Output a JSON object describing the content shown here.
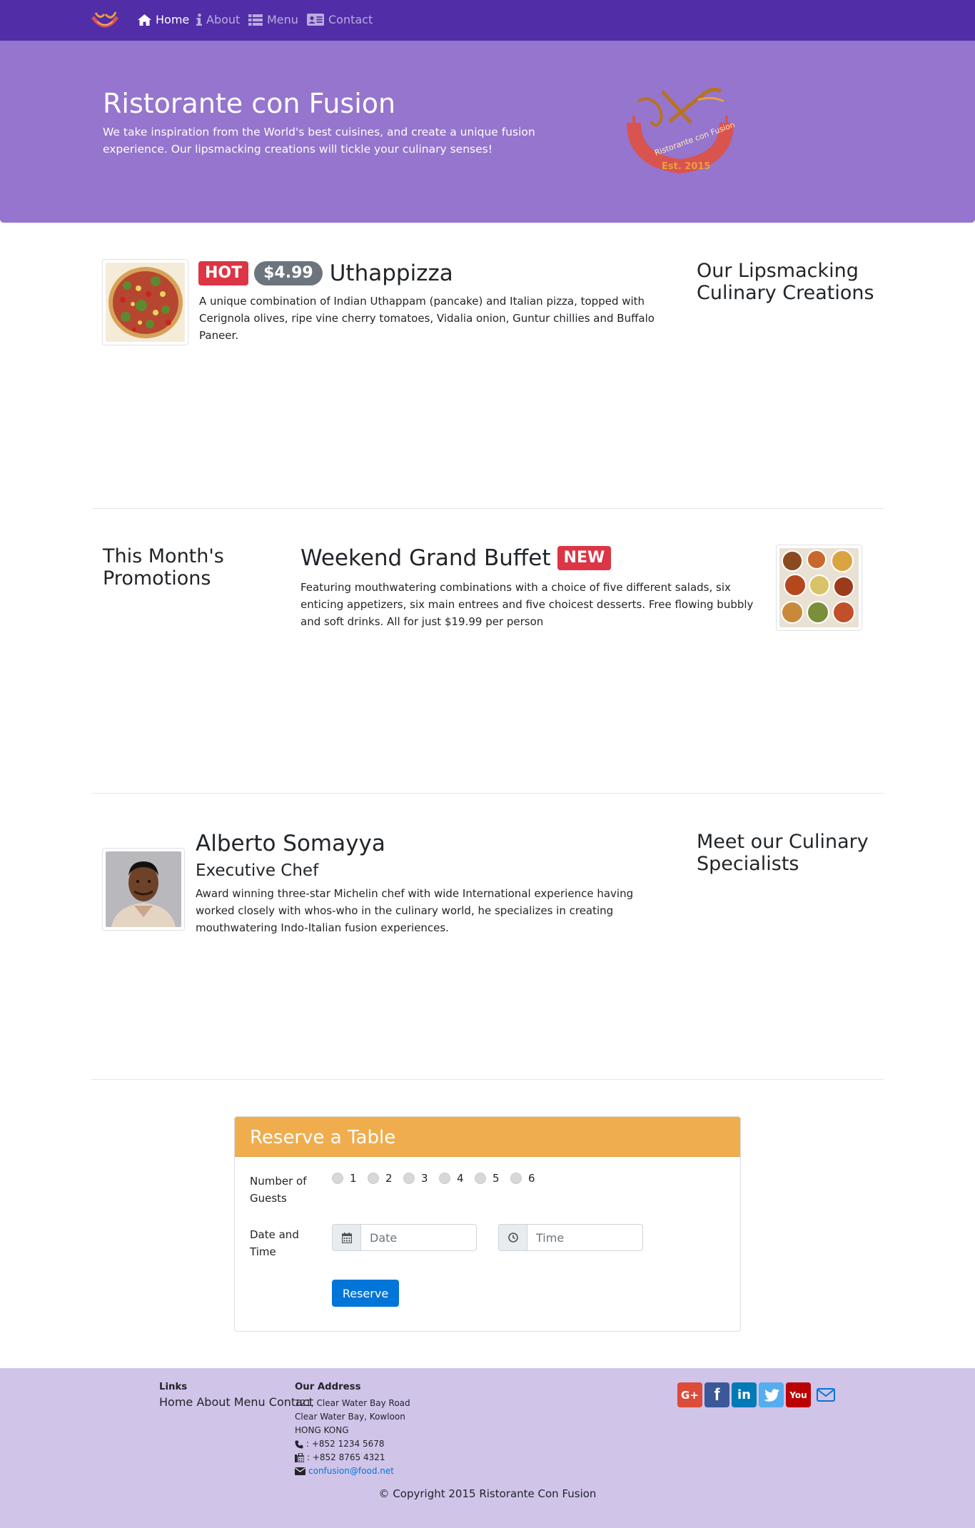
{
  "nav": {
    "brand_icon": "confusion-logo-icon",
    "items": [
      {
        "label": "Home",
        "icon": "home-icon",
        "active": true
      },
      {
        "label": "About",
        "icon": "info-icon"
      },
      {
        "label": "Menu",
        "icon": "list-icon"
      },
      {
        "label": "Contact",
        "icon": "address-card-icon"
      }
    ]
  },
  "jumbotron": {
    "title": "Ristorante con Fusion",
    "text": "We take inspiration from the World's best cuisines, and create a unique fusion experience. Our lipsmacking creations will tickle your culinary senses!",
    "logo_text": "Ristorante con Fusion",
    "logo_est": "Est. 2015"
  },
  "dish": {
    "badge_hot": "HOT",
    "price": "$4.99",
    "name": "Uthappizza",
    "description": "A unique combination of Indian Uthappam (pancake) and Italian pizza, topped with Cerignola olives, ripe vine cherry tomatoes, Vidalia onion, Guntur chillies and Buffalo Paneer.",
    "side_heading": "Our Lipsmacking Culinary Creations"
  },
  "promotion": {
    "side_heading": "This Month's Promotions",
    "name": "Weekend Grand Buffet",
    "badge_new": "NEW",
    "description": "Featuring mouthwatering combinations with a choice of five different salads, six enticing appetizers, six main entrees and five choicest desserts. Free flowing bubbly and soft drinks. All for just $19.99 per person"
  },
  "leader": {
    "name": "Alberto Somayya",
    "designation": "Executive Chef",
    "description": "Award winning three-star Michelin chef with wide International experience having worked closely with whos-who in the culinary world, he specializes in creating mouthwatering Indo-Italian fusion experiences.",
    "side_heading": "Meet our Culinary Specialists"
  },
  "reserve": {
    "title": "Reserve a Table",
    "guests_label": "Number of Guests",
    "guest_options": [
      "1",
      "2",
      "3",
      "4",
      "5",
      "6"
    ],
    "datetime_label": "Date and Time",
    "date_placeholder": "Date",
    "time_placeholder": "Time",
    "button_label": "Reserve"
  },
  "footer": {
    "links_heading": "Links",
    "links": [
      "Home",
      "About",
      "Menu",
      "Contact"
    ],
    "address_heading": "Our Address",
    "address_lines": [
      "121, Clear Water Bay Road",
      "Clear Water Bay, Kowloon",
      "HONG KONG"
    ],
    "phone": ": +852 1234 5678",
    "fax": ": +852 8765 4321",
    "email": "confusion@food.net",
    "social": [
      {
        "icon": "google-plus-icon",
        "color": "#dd4b39",
        "glyph": "G+"
      },
      {
        "icon": "facebook-icon",
        "color": "#3b5998",
        "glyph": "f"
      },
      {
        "icon": "linkedin-icon",
        "color": "#007bb6",
        "glyph": "in"
      },
      {
        "icon": "twitter-icon",
        "color": "#55acee",
        "glyph": ""
      },
      {
        "icon": "youtube-icon",
        "color": "#bb0000",
        "glyph": "You"
      },
      {
        "icon": "mail-icon",
        "color": "#0275d8",
        "glyph": ""
      }
    ],
    "copyright": "© Copyright 2015 Ristorante Con Fusion"
  }
}
